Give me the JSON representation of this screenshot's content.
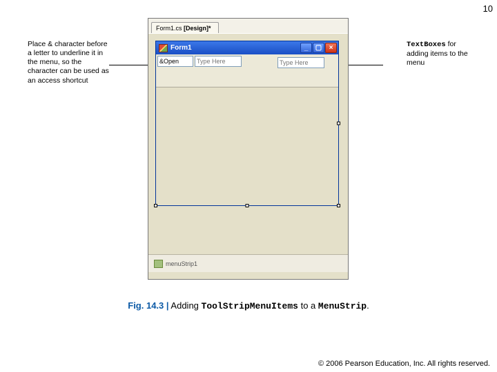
{
  "page_number": "10",
  "annotations": {
    "left": "Place & character before a letter to underline it in the menu, so the character can be used as an access shortcut",
    "right_bold": "TextBoxes",
    "right_rest": " for adding items to the menu"
  },
  "ide": {
    "tab_prefix": "Form1.cs ",
    "tab_bold": "[Design]*"
  },
  "form": {
    "title": "Form1",
    "inputs": {
      "first_value": "&Open",
      "placeholder": "Type Here"
    }
  },
  "tray": {
    "component_name": "menuStrip1"
  },
  "caption": {
    "label": "Fig. 14.3 |",
    "before": " Adding ",
    "code1": "ToolStripMenuItems",
    "middle": " to a ",
    "code2": "MenuStrip",
    "after": "."
  },
  "copyright": "© 2006 Pearson Education, Inc.  All rights reserved."
}
